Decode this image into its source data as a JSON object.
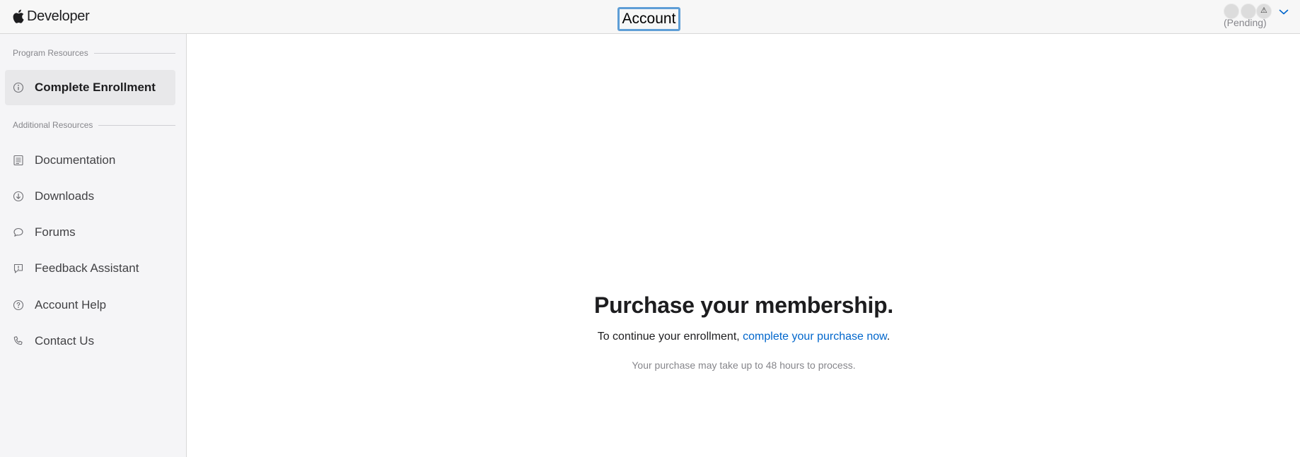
{
  "header": {
    "brand": "Developer",
    "page_title": "Account",
    "user_status": "(Pending)",
    "accent_color": "#5e9ed6"
  },
  "sidebar": {
    "sections": [
      {
        "title": "Program Resources",
        "items": [
          {
            "label": "Complete Enrollment",
            "icon": "info-circle-icon",
            "active": true
          }
        ]
      },
      {
        "title": "Additional Resources",
        "items": [
          {
            "label": "Documentation",
            "icon": "document-list-icon"
          },
          {
            "label": "Downloads",
            "icon": "download-circle-icon"
          },
          {
            "label": "Forums",
            "icon": "speech-bubble-icon"
          },
          {
            "label": "Feedback Assistant",
            "icon": "feedback-bubble-icon"
          },
          {
            "label": "Account Help",
            "icon": "question-circle-icon"
          },
          {
            "label": "Contact Us",
            "icon": "phone-icon"
          }
        ]
      }
    ]
  },
  "main": {
    "title": "Purchase your membership.",
    "line_prefix": "To continue your enrollment, ",
    "link_text": "complete your purchase now",
    "line_suffix": ".",
    "note": "Your purchase may take up to 48 hours to process.",
    "link_color": "#0066cc"
  }
}
